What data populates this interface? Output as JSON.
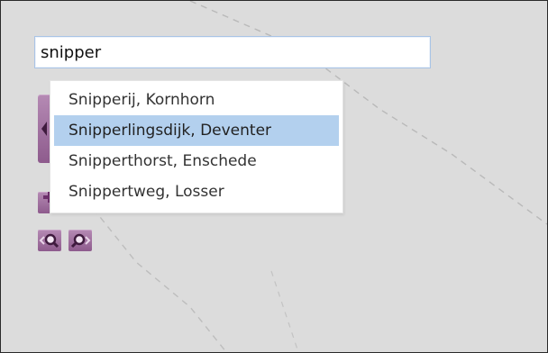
{
  "search": {
    "value": "snipper",
    "search_icon": "search-icon"
  },
  "suggestions": [
    {
      "label": "Snipperij, Kornhorn",
      "selected": false
    },
    {
      "label": "Snipperlingsdijk, Deventer",
      "selected": true
    },
    {
      "label": "Snipperthorst, Enschede",
      "selected": false
    },
    {
      "label": "Snippertweg, Losser",
      "selected": false
    }
  ],
  "map_controls": {
    "icons": [
      "pan-left-icon",
      "zoom-in-icon",
      "zoom-out-icon",
      "zoom-previous-icon",
      "zoom-next-icon"
    ]
  },
  "colors": {
    "map_background": "#dcdcdc",
    "control_purple": "#8e5b8d",
    "selection": "#b3d0ee",
    "input_border": "#a9c4e6"
  }
}
